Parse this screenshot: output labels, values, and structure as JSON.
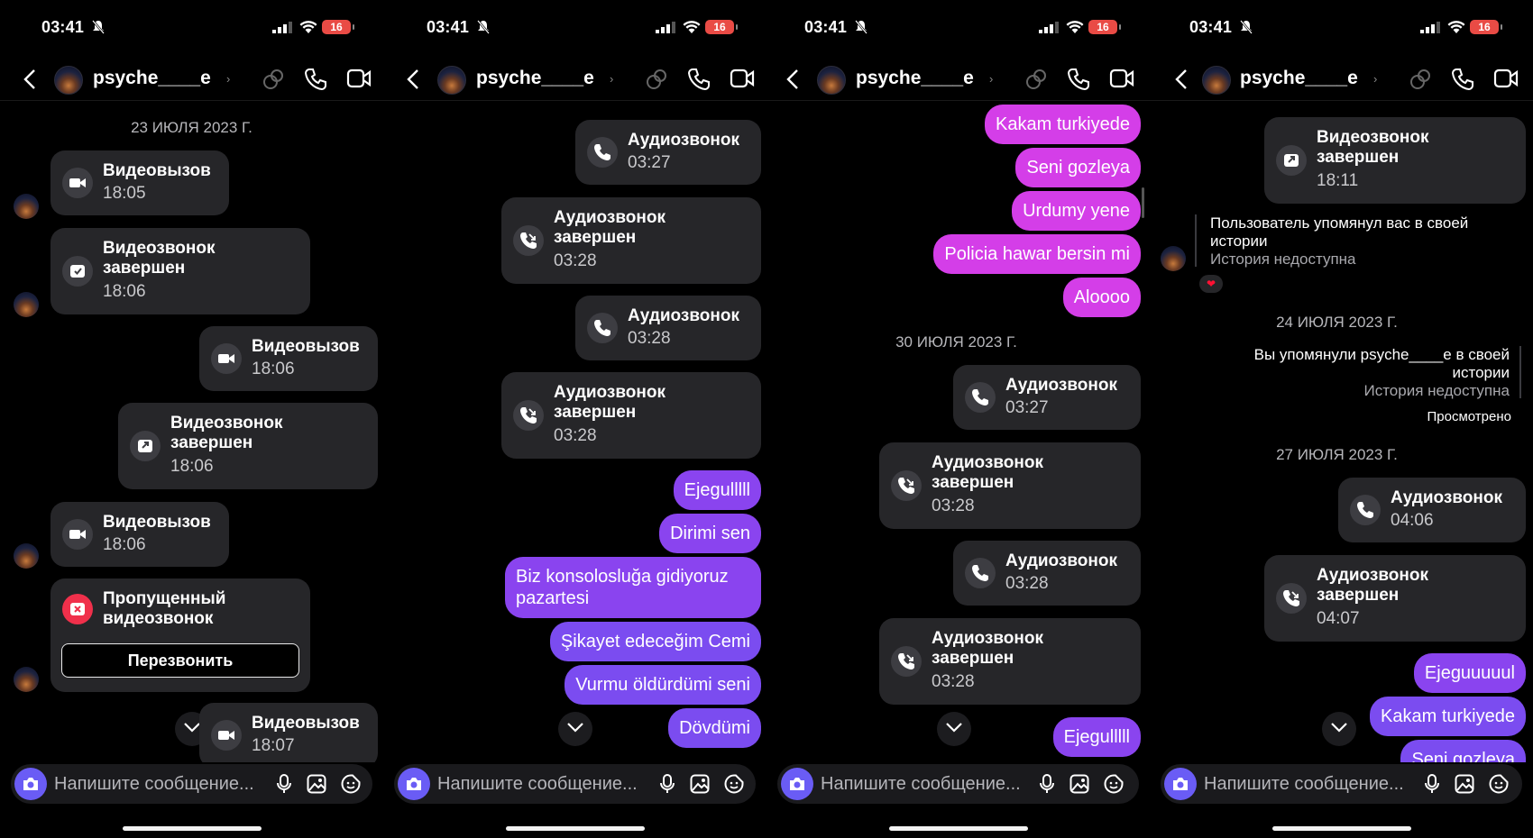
{
  "screens": [
    {
      "time": "03:41",
      "battery": "16",
      "contact": "psyche____e",
      "items": [
        {
          "date": "23 ИЮЛЯ 2023 Г."
        },
        {
          "title": "Видеовызов",
          "time": "18:05"
        },
        {
          "title": "Видеозвонок завершен",
          "time": "18:06"
        },
        {
          "title": "Видеовызов",
          "time": "18:06"
        },
        {
          "title": "Видеозвонок завершен",
          "time": "18:06"
        },
        {
          "title": "Видеовызов",
          "time": "18:06"
        },
        {
          "title": "Пропущенный видеозвонок",
          "button": "Перезвонить"
        },
        {
          "title": "Видеовызов",
          "time": "18:07"
        }
      ]
    },
    {
      "time": "03:41",
      "battery": "16",
      "contact": "psyche____e",
      "items": [
        {
          "title": "Аудиозвонок",
          "time": "03:27"
        },
        {
          "title": "Аудиозвонок завершен",
          "time": "03:28"
        },
        {
          "title": "Аудиозвонок",
          "time": "03:28"
        },
        {
          "title": "Аудиозвонок завершен",
          "time": "03:28"
        },
        {
          "text": "Ejegulllll"
        },
        {
          "text": "Dirimi sen"
        },
        {
          "text": "Biz konsolosluğa gidiyoruz pazartesi"
        },
        {
          "text": "Şikayet edeceğim Cemi"
        },
        {
          "text": "Vurmu öldürdümi seni"
        },
        {
          "text": "Dövdümi"
        }
      ]
    },
    {
      "time": "03:41",
      "battery": "16",
      "contact": "psyche____e",
      "items": [
        {
          "text": "Kakam turkiyede"
        },
        {
          "text": "Seni gozleya"
        },
        {
          "text": "Urdumy yene"
        },
        {
          "text": "Policia hawar bersin mi"
        },
        {
          "text": "Aloooo"
        },
        {
          "date": "30 ИЮЛЯ 2023 Г."
        },
        {
          "title": "Аудиозвонок",
          "time": "03:27"
        },
        {
          "title": "Аудиозвонок завершен",
          "time": "03:28"
        },
        {
          "title": "Аудиозвонок",
          "time": "03:28"
        },
        {
          "title": "Аудиозвонок завершен",
          "time": "03:28"
        },
        {
          "text": "Ejegulllll"
        }
      ]
    },
    {
      "time": "03:41",
      "battery": "16",
      "contact": "psyche____e",
      "items": [
        {
          "title": "Видеозвонок завершен",
          "time": "18:11"
        },
        {
          "mention": "Пользователь упомянул вас в своей истории",
          "note": "История недоступна"
        },
        {
          "date": "24 ИЮЛЯ 2023 Г."
        },
        {
          "mention": "Вы упомянули psyche____e в своей истории",
          "note": "История недоступна",
          "seen": "Просмотрено"
        },
        {
          "date": "27 ИЮЛЯ 2023 Г."
        },
        {
          "title": "Аудиозвонок",
          "time": "04:06"
        },
        {
          "title": "Аудиозвонок завершен",
          "time": "04:07"
        },
        {
          "text": "Ejeguuuuul"
        },
        {
          "text": "Kakam turkiyede"
        },
        {
          "text": "Seni gozleya"
        }
      ]
    }
  ],
  "composer": {
    "placeholder": "Напишите сообщение..."
  },
  "icons": [
    "back-icon",
    "chevron-right-icon",
    "effects-icon",
    "phone-icon",
    "video-icon",
    "camera-icon",
    "mic-icon",
    "gallery-icon",
    "sticker-icon",
    "chevron-down-icon",
    "video-call-icon",
    "video-call-ended-icon",
    "missed-video-icon",
    "audio-call-icon",
    "audio-call-ended-icon"
  ],
  "colors": {
    "background": "#000000",
    "bubble_received": "#262629",
    "sent_pink": "#d43ee8",
    "sent_purple": "#8a44ef",
    "missed_red": "#f0304b",
    "camera_button": "#6a5cf5",
    "battery": "#e94b45"
  }
}
